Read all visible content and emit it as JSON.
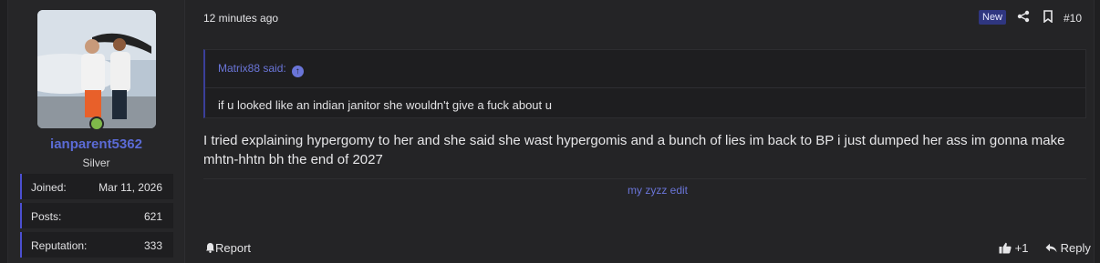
{
  "post": {
    "time": "12 minutes ago",
    "new_badge": "New",
    "post_number": "#10",
    "body": "I tried explaining hypergomy to her and she said she wast hypergomis and a bunch of lies im back to BP i just dumped her ass im gonna make mhtn-hhtn bh the end of 2027",
    "signature": "my zyzz edit",
    "actions": {
      "report": "Report",
      "like_count": "+1",
      "reply": "Reply"
    }
  },
  "quote": {
    "author": "Matrix88 said:",
    "text": "if u looked like an indian janitor she wouldn't give a fuck about u"
  },
  "user": {
    "username": "ianparent5362",
    "title": "Silver",
    "stats": [
      {
        "label": "Joined:",
        "value": "Mar 11, 2026"
      },
      {
        "label": "Posts:",
        "value": "621"
      },
      {
        "label": "Reputation:",
        "value": "333"
      }
    ],
    "online_color": "#7fb94a"
  },
  "icons": {
    "share": "share-icon",
    "bookmark": "bookmark-icon",
    "quote_arrow": "arrow-up-icon",
    "report": "bell-icon",
    "like": "thumbs-up-icon",
    "reply": "reply-icon"
  },
  "colors": {
    "accent": "#5b6bd6",
    "background": "#242426"
  }
}
